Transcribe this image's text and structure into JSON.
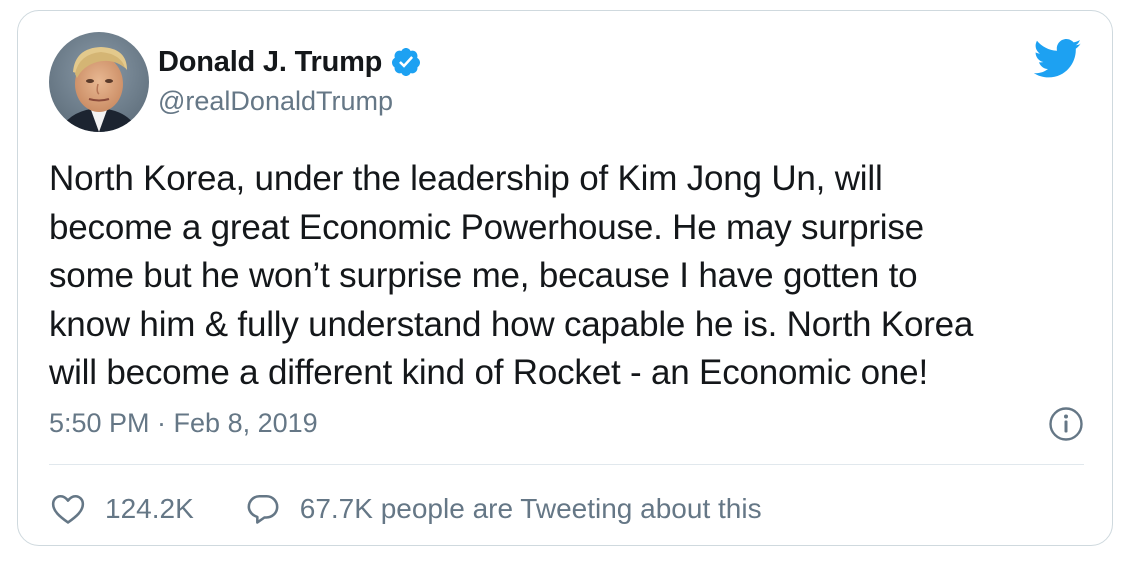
{
  "tweet": {
    "display_name": "Donald J. Trump",
    "handle": "@realDonaldTrump",
    "verified": true,
    "text": "North Korea, under the leadership of Kim Jong Un, will\nbecome a great Economic Powerhouse. He may surprise\nsome but he won’t surprise me, because I have gotten to\nknow him & fully understand how capable he is. North Korea\nwill become a different kind of Rocket - an Economic one!",
    "timestamp": "5:50 PM · Feb 8, 2019",
    "likes": "124.2K",
    "conversation": "67.7K people are Tweeting about this"
  },
  "icons": {
    "brand": "twitter-bird-icon",
    "verified": "verified-badge-icon",
    "info": "info-icon",
    "like": "heart-icon",
    "reply": "speech-bubble-icon"
  },
  "colors": {
    "brand_blue": "#1da1f2",
    "text_primary": "#14171a",
    "text_secondary": "#657786",
    "border": "#cfd9de"
  }
}
